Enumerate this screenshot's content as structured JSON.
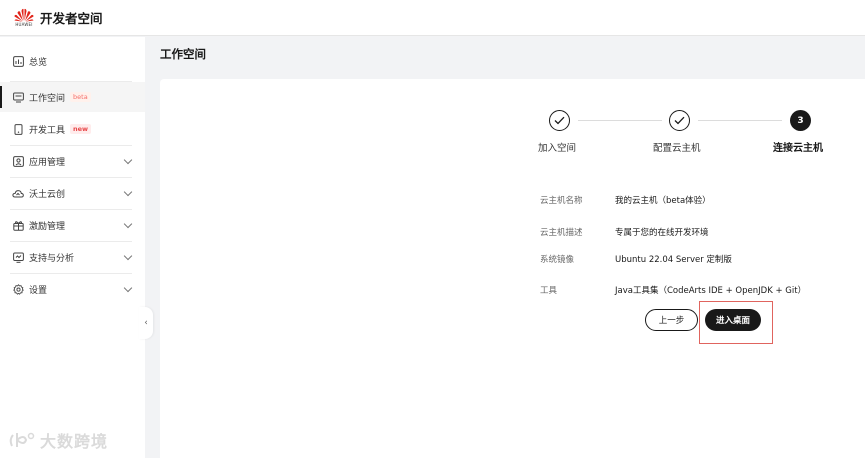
{
  "header": {
    "logo_text": "HUAWEI",
    "app_title": "开发者空间"
  },
  "sidebar": {
    "items": [
      {
        "label": "总览",
        "icon": "chart-icon"
      },
      {
        "label": "工作空间",
        "icon": "monitor-icon",
        "badge": "beta",
        "active": true
      },
      {
        "label": "开发工具",
        "icon": "phone-icon",
        "badge": "new"
      },
      {
        "label": "应用管理",
        "icon": "app-icon",
        "expandable": true
      },
      {
        "label": "沃土云创",
        "icon": "cloud-icon",
        "expandable": true
      },
      {
        "label": "激励管理",
        "icon": "gift-icon",
        "expandable": true
      },
      {
        "label": "支持与分析",
        "icon": "support-icon",
        "expandable": true
      },
      {
        "label": "设置",
        "icon": "gear-icon",
        "expandable": true
      }
    ],
    "collapse_glyph": "‹"
  },
  "main": {
    "page_title": "工作空间",
    "steps": [
      {
        "label": "加入空间",
        "status": "done"
      },
      {
        "label": "配置云主机",
        "status": "done"
      },
      {
        "label": "连接云主机",
        "status": "current",
        "number": "3"
      }
    ],
    "info": [
      {
        "label": "云主机名称",
        "value": "我的云主机（beta体验）"
      },
      {
        "label": "云主机描述",
        "value": "专属于您的在线开发环境"
      },
      {
        "label": "系统镜像",
        "value": "Ubuntu 22.04 Server 定制版"
      },
      {
        "label": "工具",
        "value": "Java工具集（CodeArts IDE + OpenJDK + Git）"
      }
    ],
    "buttons": {
      "prev": "上一步",
      "next": "进入桌面"
    }
  },
  "watermark": {
    "text": "大数跨境"
  },
  "colors": {
    "accent": "#191919",
    "brand_red": "#e1251b",
    "highlight": "#e0645e"
  }
}
